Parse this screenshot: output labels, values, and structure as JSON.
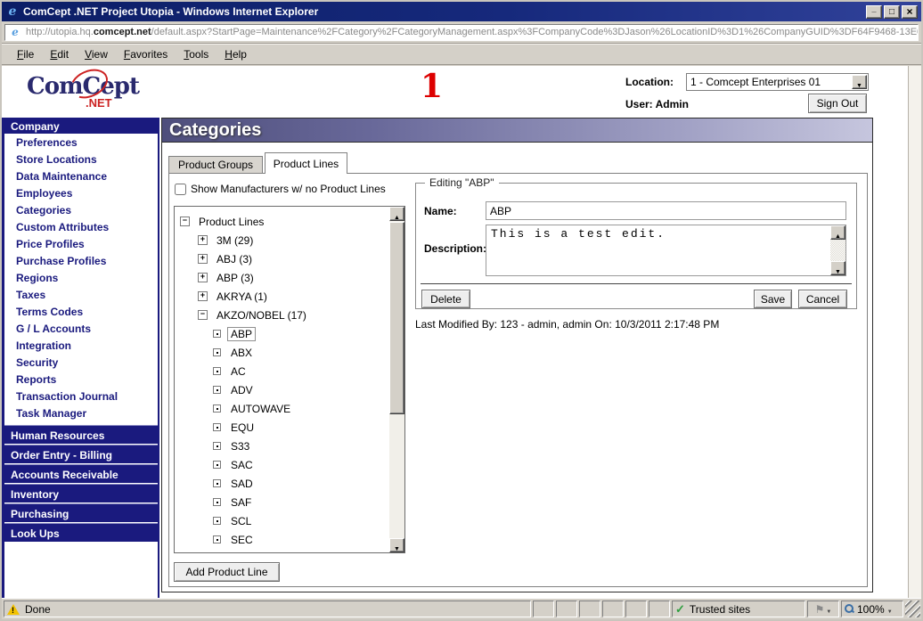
{
  "window": {
    "title": "ComCept .NET Project Utopia - Windows Internet Explorer"
  },
  "address_bar": {
    "url_prefix": "http://utopia.hq.",
    "url_domain": "comcept.net",
    "url_path": "/default.aspx?StartPage=Maintenance%2FCategory%2FCategoryManagement.aspx%3FCompanyCode%3DJason%26LocationID%3D1%26CompanyGUID%3DF64F9468-13E0"
  },
  "menu": {
    "items": [
      "File",
      "Edit",
      "View",
      "Favorites",
      "Tools",
      "Help"
    ]
  },
  "header": {
    "logo_text": "ComCept",
    "logo_net": ".NET",
    "annotation": "1",
    "location_label": "Location:",
    "location_value": "1 - Comcept Enterprises 01",
    "user_label": "User: Admin",
    "sign_out_label": "Sign Out"
  },
  "sidebar": {
    "company_header": "Company",
    "company_items": [
      {
        "label": "Preferences"
      },
      {
        "label": "Store Locations"
      },
      {
        "label": "Data Maintenance"
      },
      {
        "label": "Employees"
      },
      {
        "label": "Categories"
      },
      {
        "label": "Custom Attributes"
      },
      {
        "label": "Price Profiles"
      },
      {
        "label": "Purchase Profiles"
      },
      {
        "label": "Regions"
      },
      {
        "label": "Taxes"
      },
      {
        "label": "Terms Codes"
      },
      {
        "label": "G / L Accounts"
      },
      {
        "label": "Integration"
      },
      {
        "label": "Security"
      },
      {
        "label": "Reports"
      },
      {
        "label": "Transaction Journal"
      },
      {
        "label": "Task Manager"
      }
    ],
    "section_headers": [
      {
        "label": "Human Resources"
      },
      {
        "label": "Order Entry - Billing"
      },
      {
        "label": "Accounts Receivable"
      },
      {
        "label": "Inventory"
      },
      {
        "label": "Purchasing"
      },
      {
        "label": "Look Ups"
      }
    ]
  },
  "main": {
    "page_title": "Categories",
    "tabs": [
      {
        "label": "Product Groups",
        "active": false
      },
      {
        "label": "Product Lines",
        "active": true
      }
    ],
    "checkbox_label": "Show Manufacturers w/ no Product Lines",
    "checkbox_checked": false,
    "tree": {
      "items": [
        {
          "level": 0,
          "state": "expanded",
          "label": "Product Lines"
        },
        {
          "level": 1,
          "state": "collapsed",
          "label": "3M (29)"
        },
        {
          "level": 1,
          "state": "collapsed",
          "label": "ABJ (3)"
        },
        {
          "level": 1,
          "state": "collapsed",
          "label": "ABP (3)"
        },
        {
          "level": 1,
          "state": "collapsed",
          "label": "AKRYA (1)"
        },
        {
          "level": 1,
          "state": "expanded",
          "label": "AKZO/NOBEL (17)"
        },
        {
          "level": 2,
          "state": "leaf",
          "label": "ABP",
          "selected": true
        },
        {
          "level": 2,
          "state": "leaf",
          "label": "ABX"
        },
        {
          "level": 2,
          "state": "leaf",
          "label": "AC"
        },
        {
          "level": 2,
          "state": "leaf",
          "label": "ADV"
        },
        {
          "level": 2,
          "state": "leaf",
          "label": "AUTOWAVE"
        },
        {
          "level": 2,
          "state": "leaf",
          "label": "EQU"
        },
        {
          "level": 2,
          "state": "leaf",
          "label": "S33"
        },
        {
          "level": 2,
          "state": "leaf",
          "label": "SAC"
        },
        {
          "level": 2,
          "state": "leaf",
          "label": "SAD"
        },
        {
          "level": 2,
          "state": "leaf",
          "label": "SAF"
        },
        {
          "level": 2,
          "state": "leaf",
          "label": "SCL"
        },
        {
          "level": 2,
          "state": "leaf",
          "label": "SEC"
        }
      ]
    },
    "add_button_label": "Add Product Line",
    "editor": {
      "legend": "Editing \"ABP\"",
      "name_label": "Name:",
      "name_value": "ABP",
      "description_label": "Description:",
      "description_value": "This is a test edit.",
      "delete_label": "Delete",
      "save_label": "Save",
      "cancel_label": "Cancel",
      "last_modified": "Last Modified By: 123 - admin, admin On: 10/3/2011 2:17:48 PM"
    }
  },
  "status_bar": {
    "done_text": "Done",
    "trusted_text": "Trusted sites",
    "zoom_text": "100%"
  },
  "colors": {
    "accent_navy": "#1a1a7e",
    "titlebar_navy": "#16297c",
    "annotation_red": "#dd0000",
    "trusted_green": "#2f9e3f"
  }
}
